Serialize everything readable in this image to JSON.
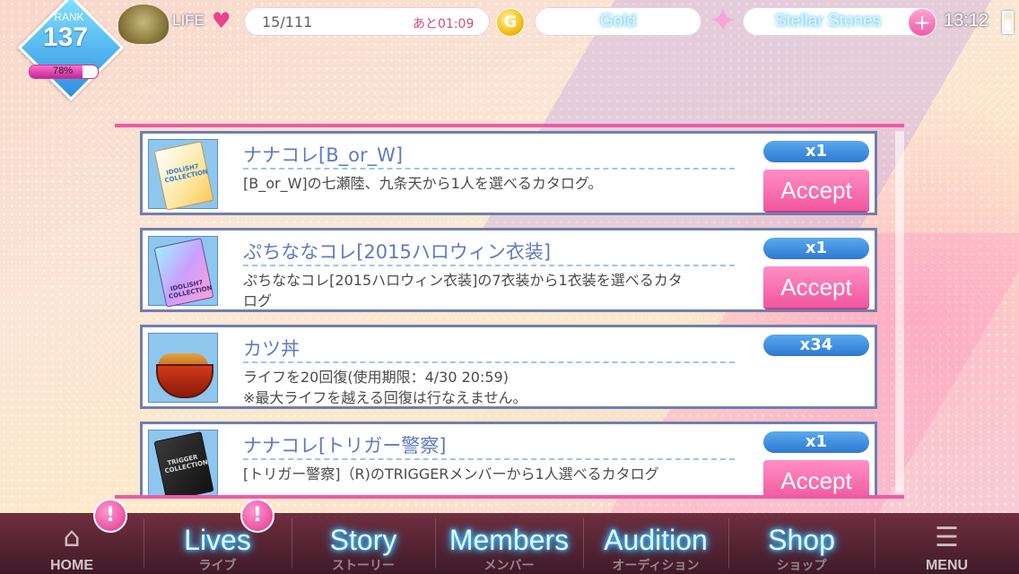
{
  "header": {
    "rank_label": "RANK",
    "rank_value": "137",
    "rank_progress_text": "78%",
    "rank_progress": 0.78,
    "life_label": "LIFE",
    "life_value": "15/111",
    "life_timer": "あと01:09",
    "gold_icon": "G",
    "gold_label": "Gold",
    "stones_label": "Stellar Stones",
    "stones_add": "+",
    "clock": "13:12"
  },
  "items": [
    {
      "title": "ナナコレ[B_or_W]",
      "qty": "x1",
      "desc": "[B_or_W]の七瀬陸、九条天から1人を選べるカタログ。",
      "accept": "Accept",
      "icon": "catalog-book-icon",
      "book_text": "IDOLiSH7 COLLECTION"
    },
    {
      "title": "ぷちななコレ[2015ハロウィン衣装]",
      "qty": "x1",
      "desc": "ぷちななコレ[2015ハロウィン衣装]の7衣装から1衣装を選べるカタログ",
      "accept": "Accept",
      "icon": "costume-catalog-icon",
      "book_text": "IDOLiSH7 COLLECTION"
    },
    {
      "title": "カツ丼",
      "qty": "x34",
      "desc": "ライフを20回復(使用期限：4/30 20:59)\n※最大ライフを越える回復は行なえません。",
      "icon": "katsudon-bowl-icon"
    },
    {
      "title": "ナナコレ[トリガー警察]",
      "qty": "x1",
      "desc": "[トリガー警察]（R)のTRIGGERメンバーから1人選べるカタログ",
      "accept": "Accept",
      "icon": "trigger-catalog-icon",
      "book_text": "TRIGGER COLLECTION"
    }
  ],
  "nav": {
    "home": "HOME",
    "lives": "Lives",
    "lives_sub": "ライブ",
    "story": "Story",
    "story_sub": "ストーリー",
    "members": "Members",
    "members_sub": "メンバー",
    "audition": "Audition",
    "audition_sub": "オーディション",
    "shop": "Shop",
    "shop_sub": "ショップ",
    "menu": "MENU",
    "notif_mark": "!"
  }
}
